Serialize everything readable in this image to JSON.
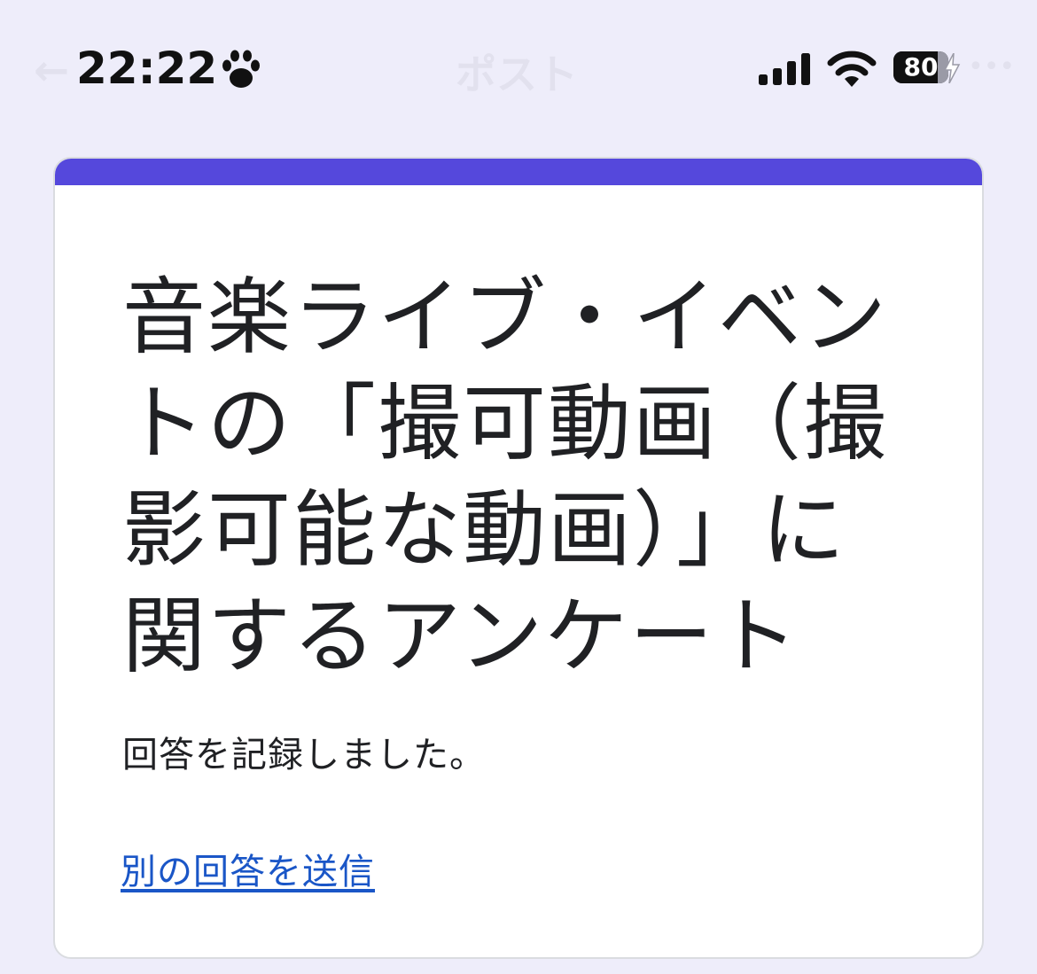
{
  "status_bar": {
    "time": "22:22",
    "battery_level": "80",
    "battery_fraction": 0.8,
    "icons": [
      "paw-icon",
      "signal-icon",
      "wifi-icon",
      "battery-icon",
      "charging-bolt-icon"
    ]
  },
  "background_header": {
    "back_icon": "←",
    "title": "ポスト",
    "more_icon": "•••"
  },
  "form": {
    "accent_color": "#5548dc",
    "title": "音楽ライブ・イベントの「撮可動画（撮影可能な動画）」に関するアンケート",
    "confirmation_message": "回答を記録しました。",
    "resubmit_link": "別の回答を送信",
    "link_color": "#1a56c7"
  }
}
